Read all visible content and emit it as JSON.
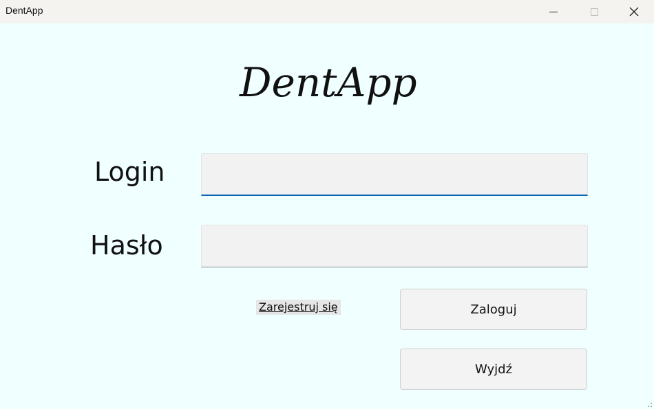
{
  "window": {
    "title": "DentApp",
    "controls": [
      "minimize-icon",
      "maximize-icon",
      "close-icon"
    ]
  },
  "logo": {
    "text": "DentApp"
  },
  "form": {
    "login_label": "Login",
    "login_value": "",
    "password_label": "Hasło",
    "password_value": ""
  },
  "links": {
    "register": "Zarejestruj się"
  },
  "buttons": {
    "login": "Zaloguj",
    "exit": "Wyjdź"
  },
  "colors": {
    "background": "#f0ffff",
    "focus_accent": "#0f64b8",
    "button_bg": "#f3f3f3"
  }
}
